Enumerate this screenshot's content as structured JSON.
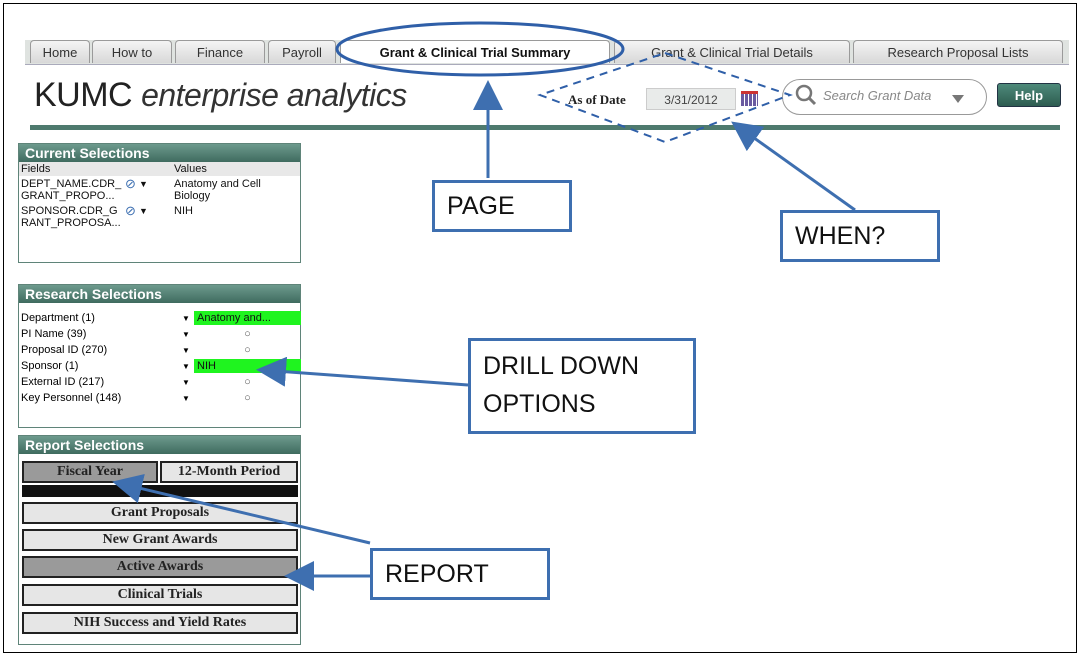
{
  "tabs": [
    "Home",
    "How to",
    "Finance",
    "Payroll",
    "Grant & Clinical Trial Summary",
    "Grant & Clinical Trial Details",
    "Research Proposal Lists"
  ],
  "logo": {
    "main": "KUMC",
    "sub": "enterprise analytics"
  },
  "as_of": {
    "label": "As of Date",
    "value": "3/31/2012"
  },
  "search": {
    "placeholder": "Search Grant Data"
  },
  "help_label": "Help",
  "current_selections": {
    "title": "Current Selections",
    "col_fields": "Fields",
    "col_values": "Values",
    "rows": [
      {
        "field": "DEPT_NAME.CDR_",
        "field2": "GRANT_PROPO...",
        "value": "Anatomy and Cell",
        "value2": "Biology"
      },
      {
        "field": "SPONSOR.CDR_G",
        "field2": "RANT_PROPOSA...",
        "value": "NIH",
        "value2": ""
      }
    ]
  },
  "research_selections": {
    "title": "Research Selections",
    "rows": [
      {
        "name": "Department  (1)",
        "value": "Anatomy and..."
      },
      {
        "name": "PI Name  (39)",
        "value": "○"
      },
      {
        "name": "Proposal ID  (270)",
        "value": "○"
      },
      {
        "name": "Sponsor  (1)",
        "value": "NIH"
      },
      {
        "name": "External ID  (217)",
        "value": "○"
      },
      {
        "name": "Key Personnel  (148)",
        "value": "○"
      }
    ]
  },
  "report_selections": {
    "title": "Report Selections",
    "period_buttons": [
      "Fiscal Year",
      "12-Month Period"
    ],
    "reports": [
      "Grant Proposals",
      "New Grant Awards",
      "Active Awards",
      "Clinical Trials",
      "NIH Success and Yield Rates"
    ]
  },
  "annotations": {
    "page": "PAGE",
    "when": "WHEN?",
    "drill1": "DRILL DOWN",
    "drill2": "OPTIONS",
    "report": "REPORT"
  },
  "colors": {
    "accent": "#4e7a6e",
    "annotation": "#3e6fb0",
    "selected": "#1ff41f"
  }
}
